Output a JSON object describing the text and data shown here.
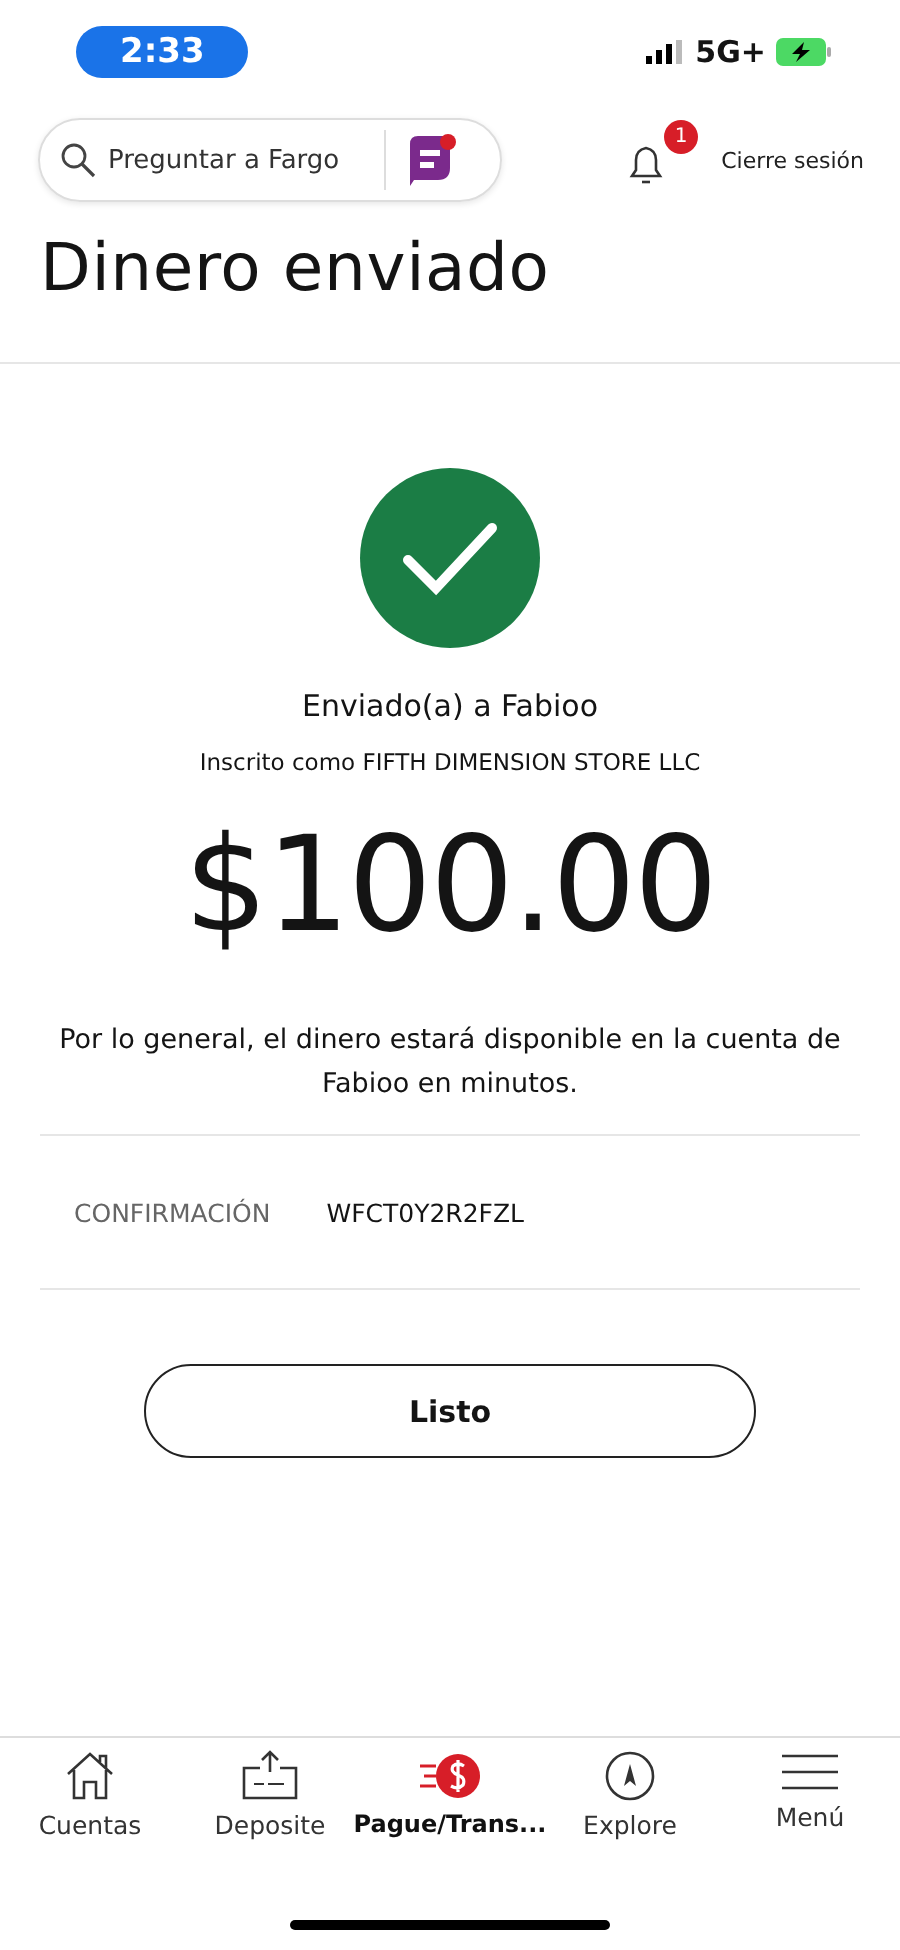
{
  "status_bar": {
    "time": "2:33",
    "network": "5G+"
  },
  "header": {
    "search": {
      "placeholder": "Preguntar a Fargo"
    },
    "notifications": {
      "badge": "1"
    },
    "logout": "Cierre sesión"
  },
  "title": "Dinero enviado",
  "result": {
    "heading": "Enviado(a) a Fabioo",
    "subheading": "Inscrito como FIFTH DIMENSION STORE LLC",
    "amount": "$100.00",
    "message": "Por lo general, el dinero estará disponible en la cuenta de Fabioo en minutos.",
    "confirmation": {
      "label": "CONFIRMACIÓN",
      "value": "WFCT0Y2R2FZL"
    }
  },
  "done_button": "Listo",
  "tab_bar": [
    {
      "kind": "home",
      "label": "Cuentas",
      "selected": false
    },
    {
      "kind": "deposit",
      "label": "Deposite",
      "selected": false
    },
    {
      "kind": "pay",
      "label": "Pague/Trans...",
      "selected": true
    },
    {
      "kind": "explore",
      "label": "Explore",
      "selected": false
    },
    {
      "kind": "menu",
      "label": "Menú",
      "selected": false
    }
  ]
}
